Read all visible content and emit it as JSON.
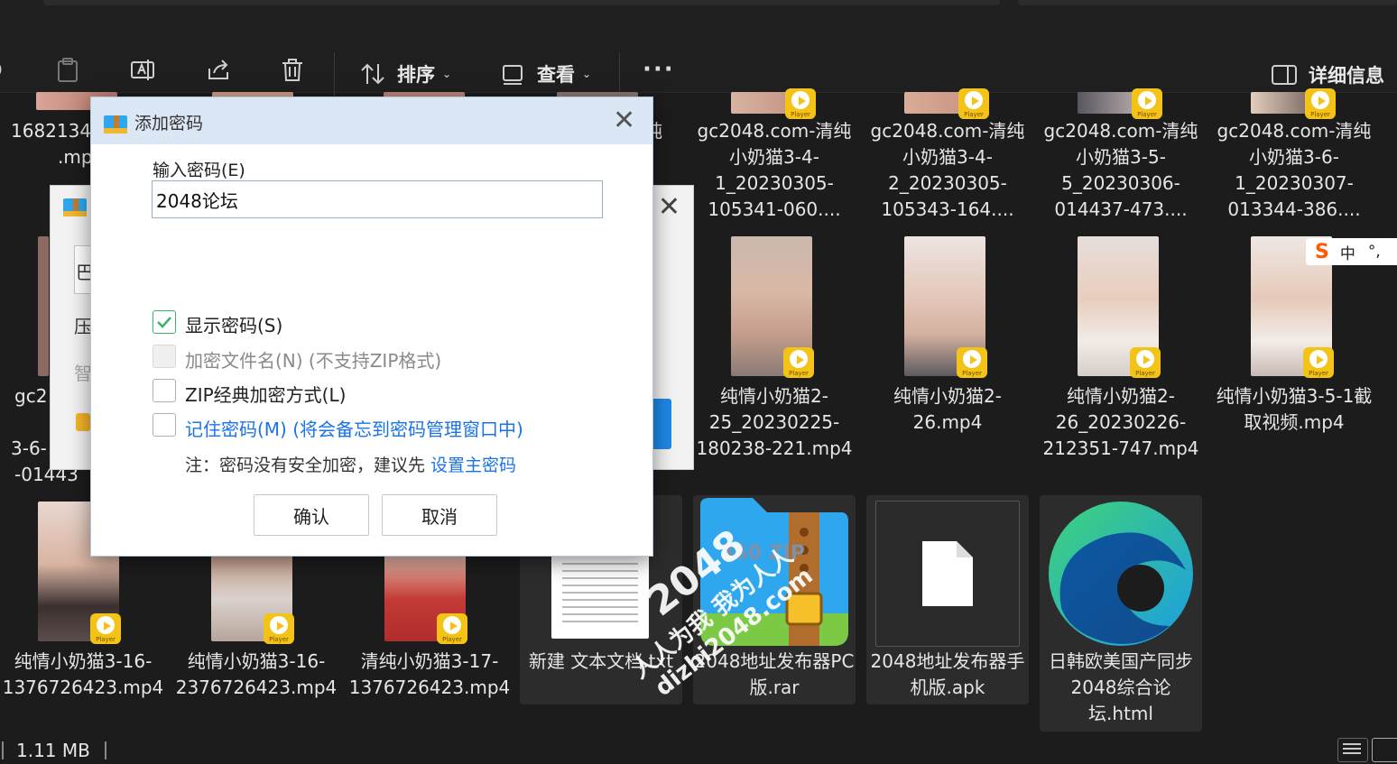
{
  "toolbar": {
    "sort_label": "排序",
    "view_label": "查看",
    "more_label": "···",
    "details_label": "详细信息"
  },
  "files_row1": [
    {
      "name": "1682134",
      "sub": ".mp"
    },
    {
      "name": "纯"
    },
    {
      "name": "gc2048.com-清纯小奶猫3-4-1_20230305-105341-060...."
    },
    {
      "name": "gc2048.com-清纯小奶猫3-4-2_20230305-105343-164...."
    },
    {
      "name": "gc2048.com-清纯小奶猫3-5-5_20230306-014437-473...."
    },
    {
      "name": "gc2048.com-清纯小奶猫3-6-1_20230307-013344-386...."
    }
  ],
  "files_row2": [
    {
      "name": "gc2",
      "sub1": "3-6-",
      "sub2": "-01443"
    },
    {
      "name": "纯情小奶猫2-25_20230225-180238-221.mp4"
    },
    {
      "name": "纯情小奶猫2-26.mp4"
    },
    {
      "name": "纯情小奶猫2-26_20230226-212351-747.mp4"
    },
    {
      "name": "纯情小奶猫3-5-1截取视频.mp4"
    }
  ],
  "files_row3": [
    {
      "name": "纯情小奶猫3-16-1376726423.mp4"
    },
    {
      "name": "纯情小奶猫3-16-2376726423.mp4"
    },
    {
      "name": "清纯小奶猫3-17-1376726423.mp4"
    },
    {
      "name": "新建 文本文档.txt"
    },
    {
      "name": "2048地址发布器PC版.rar"
    },
    {
      "name": "2048地址发布器手机版.apk"
    },
    {
      "name": "日韩欧美国产同步 2048综合论坛.html"
    }
  ],
  "player_badge": "Player",
  "zip_icon_text": "360 ZIP",
  "status": {
    "size": "1.11 MB"
  },
  "dialog": {
    "title": "添加密码",
    "input_label": "输入密码(E)",
    "password_value": "2048论坛",
    "show_password": "显示密码(S)",
    "encrypt_names": "加密文件名(N) (不支持ZIP格式)",
    "zip_classic": "ZIP经典加密方式(L)",
    "remember": "记住密码(M) (将会备忘到密码管理窗口中)",
    "note_prefix": "注：密码没有安全加密，建议先 ",
    "note_link": "设置主密码",
    "ok": "确认",
    "cancel": "取消"
  },
  "bg_dialog": {
    "label_1": "巴",
    "label_2": "压",
    "label_3": "智"
  },
  "ime": {
    "mode": "中",
    "punct": "°,"
  },
  "watermark": {
    "line1": "2048",
    "line2": "人人为我 我为人人",
    "line3": "dizhi2048.com"
  }
}
